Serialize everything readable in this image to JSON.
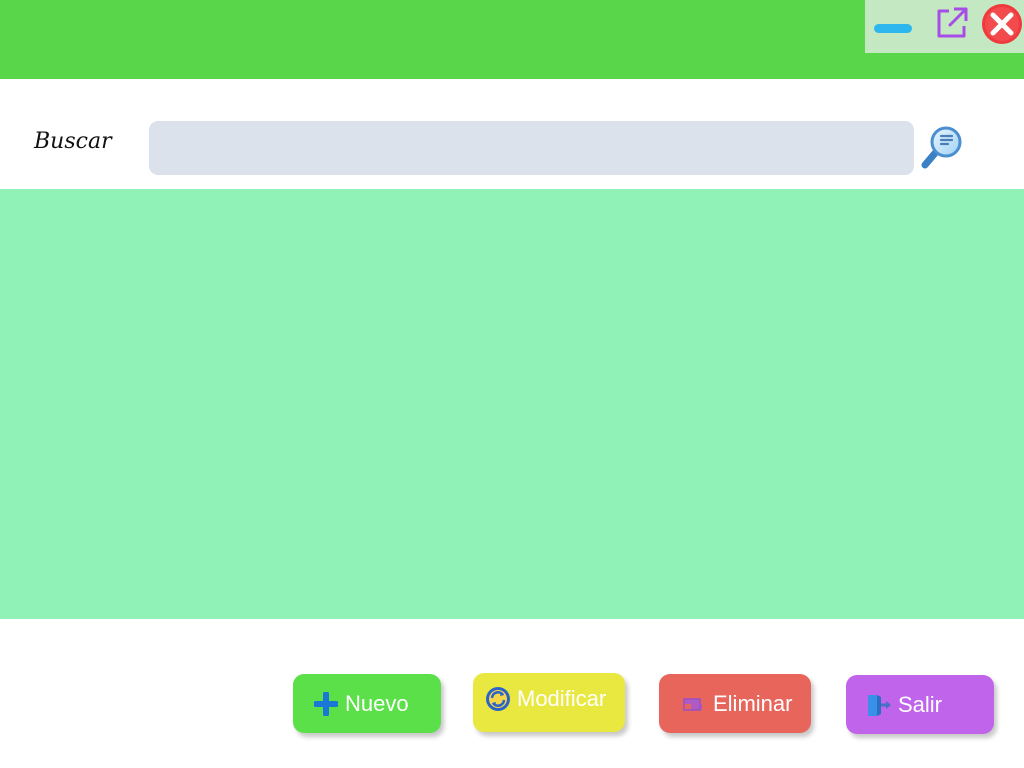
{
  "window": {
    "controls": {
      "minimize_icon": "minimize-icon",
      "maximize_icon": "external-link-icon",
      "close_icon": "close-icon"
    }
  },
  "search": {
    "label": "Buscar",
    "value": "",
    "placeholder": "",
    "button_icon": "magnifier-icon"
  },
  "actions": {
    "nuevo": {
      "label": "Nuevo",
      "icon": "plus-icon",
      "color": "#5be04a"
    },
    "modificar": {
      "label": "Modificar",
      "icon": "refresh-icon",
      "color": "#e9e840"
    },
    "eliminar": {
      "label": "Eliminar",
      "icon": "delete-icon",
      "color": "#e8655c"
    },
    "salir": {
      "label": "Salir",
      "icon": "exit-door-icon",
      "color": "#c064ec"
    }
  },
  "colors": {
    "titlebar": "#59d64a",
    "content_area": "#91f2b7",
    "search_field": "#dbe2ec"
  }
}
